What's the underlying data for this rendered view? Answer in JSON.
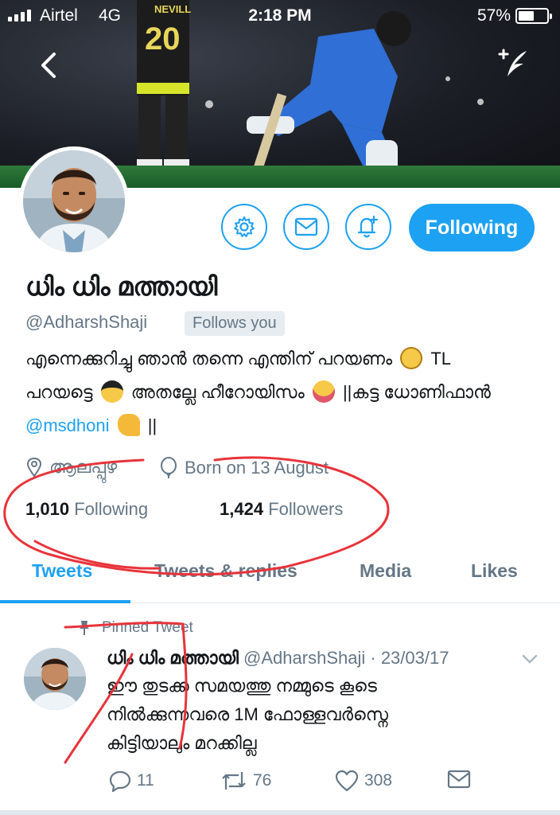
{
  "status_bar": {
    "carrier": "Airtel",
    "network": "4G",
    "time": "2:18 PM",
    "battery": "57%",
    "battery_level": 0.57
  },
  "header": {
    "back_icon": "chevron-left-icon",
    "compose_icon": "compose-tweet-icon",
    "banner_jersey_name": "NEVILL",
    "banner_jersey_number": "20"
  },
  "profile": {
    "display_name": "ധിം ധിം മത്തായി",
    "handle": "@AdharshShaji",
    "follows_you": "Follows you",
    "bio_line1": "എന്നെക്കുറിച്ചു ഞാൻ തന്നെ എന്തിന് പറയണം",
    "bio_line1_end": "TL",
    "bio_line2_start": "പറയട്ടെ",
    "bio_line2_mid": "അതല്ലേ ഹീറോയിസം",
    "bio_line2_end": "||കട്ട ധോണിഫാൻ",
    "bio_mention": "@msdhoni",
    "bio_line3_end": "||",
    "location": "ആലപ്പുഴ",
    "birthday": "Born on 13 August",
    "following_count": "1,010",
    "following_label": "Following",
    "followers_count": "1,424",
    "followers_label": "Followers"
  },
  "actions": {
    "settings_icon": "gear-icon",
    "message_icon": "envelope-icon",
    "notify_icon": "bell-plus-icon",
    "follow_label": "Following"
  },
  "tabs": [
    {
      "label": "Tweets",
      "active": true
    },
    {
      "label": "Tweets & replies",
      "active": false
    },
    {
      "label": "Media",
      "active": false
    },
    {
      "label": "Likes",
      "active": false
    }
  ],
  "tweet": {
    "pinned_label": "Pinned Tweet",
    "author_name": "ധിം ധിം മത്തായി",
    "author_handle": "@AdharshShaji",
    "date": "· 23/03/17",
    "text_line1": "ഈ തുടക്ക സമയത്തു നമ്മുടെ കൂടെ",
    "text_line2": "നിൽക്കുന്നവരെ 1M ഫോള്ളവർസ്നെ",
    "text_line3": "കിട്ടിയാലും മറക്കില്ല",
    "replies": "11",
    "retweets": "76",
    "likes": "308"
  },
  "colors": {
    "accent": "#1da1f2",
    "muted": "#657786",
    "annotation": "#e8333a"
  }
}
